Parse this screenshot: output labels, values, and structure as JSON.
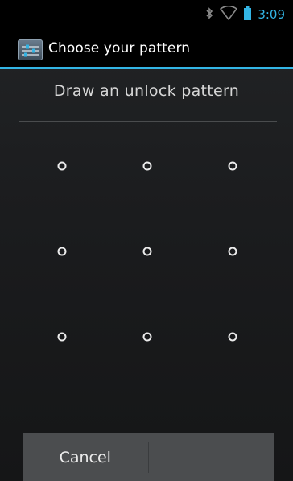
{
  "status_bar": {
    "time": "3:09",
    "icons": [
      "bluetooth-icon",
      "wifi-icon",
      "battery-icon"
    ],
    "accent_color": "#33b5e5"
  },
  "title_bar": {
    "title": "Choose your pattern",
    "icon": "settings-app-icon"
  },
  "header": {
    "text": "Draw an unlock pattern"
  },
  "pattern": {
    "rows": 3,
    "cols": 3,
    "dot_color": "#ececec"
  },
  "buttons": {
    "cancel_label": "Cancel",
    "continue_label": ""
  }
}
